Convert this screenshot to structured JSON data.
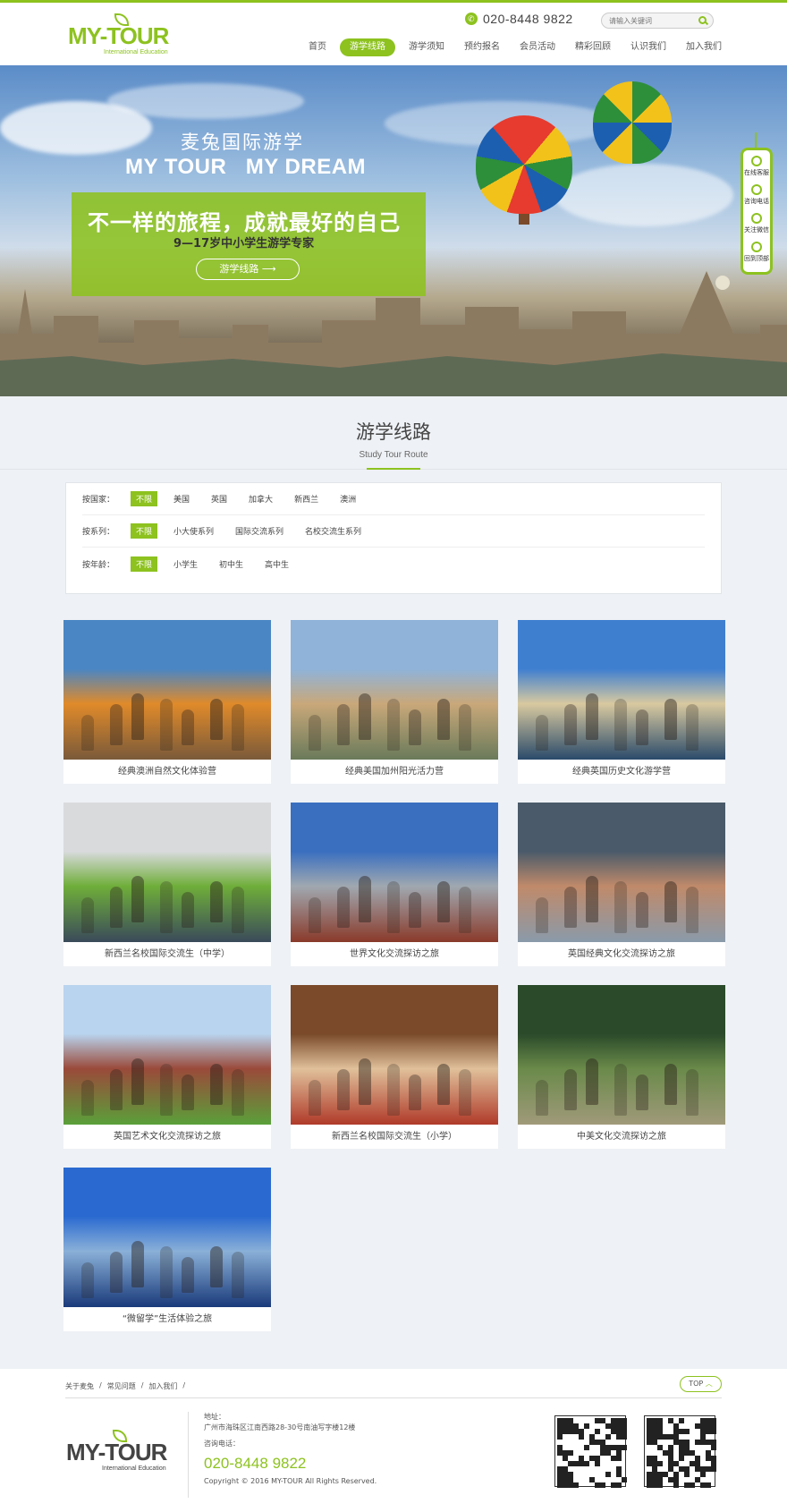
{
  "brand": {
    "logo_text": "MY-TOUR",
    "logo_sub": "International Education",
    "phone": "020-8448 9822",
    "accent": "#8dc21f"
  },
  "search": {
    "placeholder": "请输入关键词"
  },
  "nav": [
    {
      "label": "首页",
      "active": false
    },
    {
      "label": "游学线路",
      "active": true
    },
    {
      "label": "游学须知",
      "active": false
    },
    {
      "label": "预约报名",
      "active": false
    },
    {
      "label": "会员活动",
      "active": false
    },
    {
      "label": "精彩回顾",
      "active": false
    },
    {
      "label": "认识我们",
      "active": false
    },
    {
      "label": "加入我们",
      "active": false
    }
  ],
  "banner": {
    "title_cn": "麦兔国际游学",
    "title_en": "MY TOUR   MY DREAM",
    "slogan": "不一样的旅程，成就最好的自己",
    "sub": "9—17岁中小学生游学专家",
    "button": "游学线路 ⟶"
  },
  "sidebar": [
    {
      "label": "在线客服",
      "icon": "chat-icon"
    },
    {
      "label": "咨询电话",
      "icon": "phone-icon"
    },
    {
      "label": "关注微信",
      "icon": "wechat-icon"
    },
    {
      "label": "回到顶部",
      "icon": "up-icon"
    }
  ],
  "section": {
    "title": "游学线路",
    "subtitle": "Study Tour Route"
  },
  "filters": [
    {
      "label": "按国家：",
      "options": [
        "不限",
        "美国",
        "英国",
        "加拿大",
        "新西兰",
        "澳洲"
      ]
    },
    {
      "label": "按系列：",
      "options": [
        "不限",
        "小大使系列",
        "国际交流系列",
        "名校交流生系列"
      ]
    },
    {
      "label": "按年龄：",
      "options": [
        "不限",
        "小学生",
        "初中生",
        "高中生"
      ]
    }
  ],
  "tours": [
    {
      "title": "经典澳洲自然文化体验营",
      "colors": [
        "#4a86c4",
        "#e08a2a",
        "#7a5a3a"
      ]
    },
    {
      "title": "经典美国加州阳光活力营",
      "colors": [
        "#8fb3d9",
        "#c9a87a",
        "#6a7a5a"
      ]
    },
    {
      "title": "经典英国历史文化游学营",
      "colors": [
        "#3f7fd0",
        "#d8c9a0",
        "#2a4a6a"
      ]
    },
    {
      "title": "新西兰名校国际交流生（中学）",
      "colors": [
        "#d8dadc",
        "#6fae3a",
        "#3a4a5a"
      ]
    },
    {
      "title": "世界文化交流探访之旅",
      "colors": [
        "#3a6fc0",
        "#a0a8b0",
        "#8a3a2a"
      ]
    },
    {
      "title": "英国经典文化交流探访之旅",
      "colors": [
        "#4a5a6a",
        "#c08a6a",
        "#8a9aaa"
      ]
    },
    {
      "title": "英国艺术文化交流探访之旅",
      "colors": [
        "#b9d4ef",
        "#9a4a3a",
        "#5aa03a"
      ]
    },
    {
      "title": "新西兰名校国际交流生（小学）",
      "colors": [
        "#7a4a2a",
        "#e0c09a",
        "#b03a2a"
      ]
    },
    {
      "title": "中美文化交流探访之旅",
      "colors": [
        "#2a4a2a",
        "#6a8a4a",
        "#a09a7a"
      ]
    },
    {
      "title": "“微留学”生活体验之旅",
      "colors": [
        "#2a6ad0",
        "#8ab0d8",
        "#1a3a7a"
      ]
    }
  ],
  "footer": {
    "links": [
      "关于麦兔",
      "常见问题",
      "加入我们"
    ],
    "top": "TOP",
    "address_label": "地址：",
    "address": "广州市海珠区江南西路28-30号南油写字楼12楼",
    "phone_label": "咨询电话：",
    "phone": "020-8448 9822",
    "copyright": "Copyright © 2016 MY-TOUR All Rights Reserved."
  }
}
